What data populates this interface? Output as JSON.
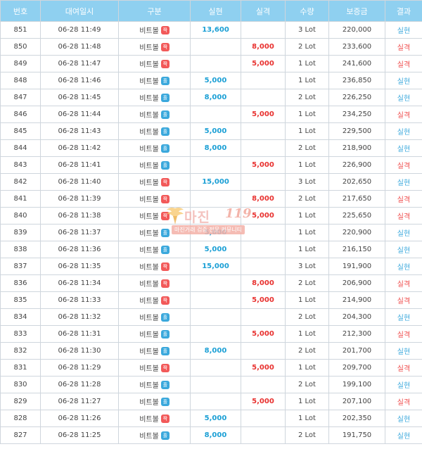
{
  "headers": [
    "번호",
    "대여일시",
    "구분",
    "실현",
    "실격",
    "수량",
    "보증금",
    "결과"
  ],
  "product_label": "비트볼",
  "badge_labels": {
    "blue": "홀",
    "red": "짝"
  },
  "watermark": {
    "title": "마진",
    "number": "119",
    "subtitle": "마진거래 검증 전문 커뮤니티"
  },
  "colors": {
    "header_bg": "#8fd0f0",
    "realized": "#1a9fd5",
    "loss": "#e8312f",
    "badge_blue": "#3aa8dc",
    "badge_red": "#f25959"
  },
  "rows": [
    {
      "no": "851",
      "datetime": "06-28 11:49",
      "badge": "red",
      "realized": "13,600",
      "loss": "",
      "qty": "3 Lot",
      "deposit": "220,000",
      "result": "실현"
    },
    {
      "no": "850",
      "datetime": "06-28 11:48",
      "badge": "red",
      "realized": "",
      "loss": "8,000",
      "qty": "2 Lot",
      "deposit": "233,600",
      "result": "실격"
    },
    {
      "no": "849",
      "datetime": "06-28 11:47",
      "badge": "red",
      "realized": "",
      "loss": "5,000",
      "qty": "1 Lot",
      "deposit": "241,600",
      "result": "실격"
    },
    {
      "no": "848",
      "datetime": "06-28 11:46",
      "badge": "blue",
      "realized": "5,000",
      "loss": "",
      "qty": "1 Lot",
      "deposit": "236,850",
      "result": "실현"
    },
    {
      "no": "847",
      "datetime": "06-28 11:45",
      "badge": "blue",
      "realized": "8,000",
      "loss": "",
      "qty": "2 Lot",
      "deposit": "226,250",
      "result": "실현"
    },
    {
      "no": "846",
      "datetime": "06-28 11:44",
      "badge": "blue",
      "realized": "",
      "loss": "5,000",
      "qty": "1 Lot",
      "deposit": "234,250",
      "result": "실격"
    },
    {
      "no": "845",
      "datetime": "06-28 11:43",
      "badge": "blue",
      "realized": "5,000",
      "loss": "",
      "qty": "1 Lot",
      "deposit": "229,500",
      "result": "실현"
    },
    {
      "no": "844",
      "datetime": "06-28 11:42",
      "badge": "blue",
      "realized": "8,000",
      "loss": "",
      "qty": "2 Lot",
      "deposit": "218,900",
      "result": "실현"
    },
    {
      "no": "843",
      "datetime": "06-28 11:41",
      "badge": "blue",
      "realized": "",
      "loss": "5,000",
      "qty": "1 Lot",
      "deposit": "226,900",
      "result": "실격"
    },
    {
      "no": "842",
      "datetime": "06-28 11:40",
      "badge": "red",
      "realized": "15,000",
      "loss": "",
      "qty": "3 Lot",
      "deposit": "202,650",
      "result": "실현"
    },
    {
      "no": "841",
      "datetime": "06-28 11:39",
      "badge": "red",
      "realized": "",
      "loss": "8,000",
      "qty": "2 Lot",
      "deposit": "217,650",
      "result": "실격"
    },
    {
      "no": "840",
      "datetime": "06-28 11:38",
      "badge": "red",
      "realized": "",
      "loss": "5,000",
      "qty": "1 Lot",
      "deposit": "225,650",
      "result": "실격"
    },
    {
      "no": "839",
      "datetime": "06-28 11:37",
      "badge": "blue",
      "realized": "5,000",
      "loss": "",
      "qty": "1 Lot",
      "deposit": "220,900",
      "result": "실현"
    },
    {
      "no": "838",
      "datetime": "06-28 11:36",
      "badge": "blue",
      "realized": "5,000",
      "loss": "",
      "qty": "1 Lot",
      "deposit": "216,150",
      "result": "실현"
    },
    {
      "no": "837",
      "datetime": "06-28 11:35",
      "badge": "red",
      "realized": "15,000",
      "loss": "",
      "qty": "3 Lot",
      "deposit": "191,900",
      "result": "실현"
    },
    {
      "no": "836",
      "datetime": "06-28 11:34",
      "badge": "red",
      "realized": "",
      "loss": "8,000",
      "qty": "2 Lot",
      "deposit": "206,900",
      "result": "실격"
    },
    {
      "no": "835",
      "datetime": "06-28 11:33",
      "badge": "red",
      "realized": "",
      "loss": "5,000",
      "qty": "1 Lot",
      "deposit": "214,900",
      "result": "실격"
    },
    {
      "no": "834",
      "datetime": "06-28 11:32",
      "badge": "blue",
      "realized": "",
      "loss": "",
      "qty": "2 Lot",
      "deposit": "204,300",
      "result": "실현"
    },
    {
      "no": "833",
      "datetime": "06-28 11:31",
      "badge": "blue",
      "realized": "",
      "loss": "5,000",
      "qty": "1 Lot",
      "deposit": "212,300",
      "result": "실격"
    },
    {
      "no": "832",
      "datetime": "06-28 11:30",
      "badge": "blue",
      "realized": "8,000",
      "loss": "",
      "qty": "2 Lot",
      "deposit": "201,700",
      "result": "실현"
    },
    {
      "no": "831",
      "datetime": "06-28 11:29",
      "badge": "red",
      "realized": "",
      "loss": "5,000",
      "qty": "1 Lot",
      "deposit": "209,700",
      "result": "실격"
    },
    {
      "no": "830",
      "datetime": "06-28 11:28",
      "badge": "blue",
      "realized": "",
      "loss": "",
      "qty": "2 Lot",
      "deposit": "199,100",
      "result": "실현"
    },
    {
      "no": "829",
      "datetime": "06-28 11:27",
      "badge": "blue",
      "realized": "",
      "loss": "5,000",
      "qty": "1 Lot",
      "deposit": "207,100",
      "result": "실격"
    },
    {
      "no": "828",
      "datetime": "06-28 11:26",
      "badge": "red",
      "realized": "5,000",
      "loss": "",
      "qty": "1 Lot",
      "deposit": "202,350",
      "result": "실현"
    },
    {
      "no": "827",
      "datetime": "06-28 11:25",
      "badge": "blue",
      "realized": "8,000",
      "loss": "",
      "qty": "2 Lot",
      "deposit": "191,750",
      "result": "실현"
    }
  ]
}
